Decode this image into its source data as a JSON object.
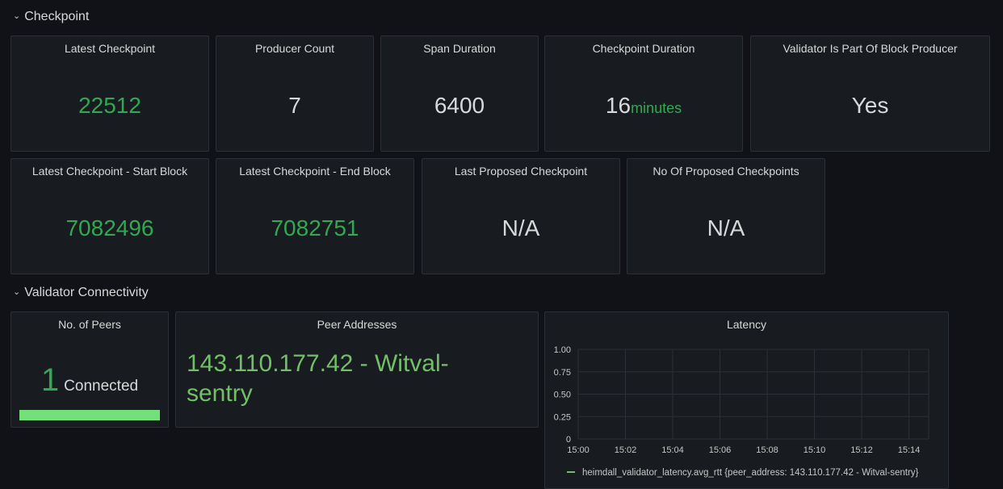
{
  "rows": {
    "checkpoint": "Checkpoint",
    "connectivity": "Validator Connectivity"
  },
  "panels": {
    "latest_checkpoint": {
      "title": "Latest Checkpoint",
      "value": "22512"
    },
    "producer_count": {
      "title": "Producer Count",
      "value": "7"
    },
    "span_duration": {
      "title": "Span Duration",
      "value": "6400"
    },
    "checkpoint_duration": {
      "title": "Checkpoint Duration",
      "value": "16",
      "unit": "minutes"
    },
    "validator_block_producer": {
      "title": "Validator Is Part Of Block Producer",
      "value": "Yes"
    },
    "start_block": {
      "title": "Latest Checkpoint - Start Block",
      "value": "7082496"
    },
    "end_block": {
      "title": "Latest Checkpoint - End Block",
      "value": "7082751"
    },
    "last_proposed": {
      "title": "Last Proposed Checkpoint",
      "value": "N/A"
    },
    "no_proposed": {
      "title": "No Of Proposed Checkpoints",
      "value": "N/A"
    },
    "peers": {
      "title": "No. of Peers",
      "value": "1",
      "unit": "Connected",
      "gauge_fraction": 1.0
    },
    "peer_addresses": {
      "title": "Peer Addresses",
      "value": "143.110.177.42 - Witval-sentry"
    },
    "latency": {
      "title": "Latency"
    }
  },
  "colors": {
    "green": "#32a852",
    "bright_green": "#73bf69",
    "gauge_green": "#73e07a",
    "background": "#111217",
    "panel": "#181b1f"
  },
  "chart_data": {
    "type": "line",
    "title": "Latency",
    "x_ticks": [
      "15:00",
      "15:02",
      "15:04",
      "15:06",
      "15:08",
      "15:10",
      "15:12",
      "15:14"
    ],
    "y_ticks": [
      "1.00",
      "0.75",
      "0.50",
      "0.25",
      "0"
    ],
    "ylim": [
      0,
      1
    ],
    "grid": true,
    "legend_position": "bottom",
    "series": [
      {
        "name": "heimdall_validator_latency.avg_rtt {peer_address: 143.110.177.42 - Witval-sentry}",
        "values": [],
        "color": "#73bf69"
      }
    ]
  }
}
